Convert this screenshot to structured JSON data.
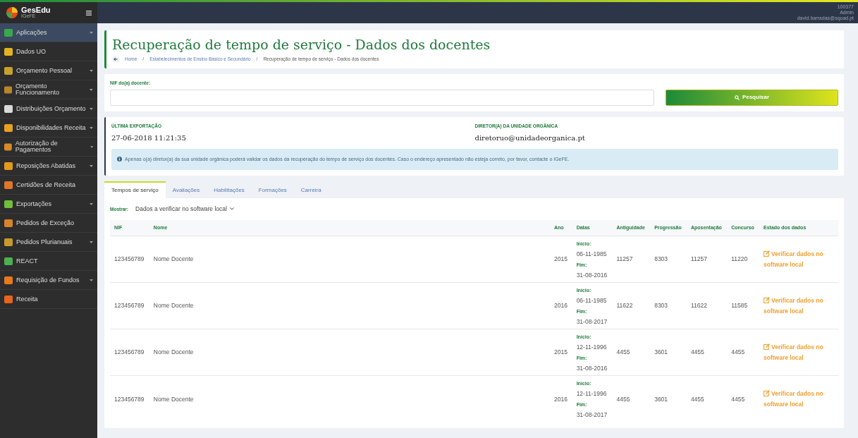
{
  "brand": {
    "name": "GesEdu",
    "sub": "IGeFE"
  },
  "user": {
    "id": "100377",
    "role": "Admin",
    "email": "david.barradas@squad.pt"
  },
  "sidebar": {
    "items": [
      {
        "label": "Aplicações",
        "selected": true,
        "expandable": true,
        "color": "#3aa84a"
      },
      {
        "label": "Dados UO",
        "selected": false,
        "expandable": false,
        "color": "#e3b321"
      },
      {
        "label": "Orçamento Pessoal",
        "selected": false,
        "expandable": true,
        "color": "#c7a12b"
      },
      {
        "label": "Orçamento Funcionamento",
        "selected": false,
        "expandable": true,
        "color": "#b8862b"
      },
      {
        "label": "Distribuições Orçamento",
        "selected": false,
        "expandable": true,
        "color": "#d9d9d9"
      },
      {
        "label": "Disponibilidades Receita",
        "selected": false,
        "expandable": true,
        "color": "#e8a020"
      },
      {
        "label": "Autorização de Pagamentos",
        "selected": false,
        "expandable": true,
        "color": "#d98a2b"
      },
      {
        "label": "Reposições Abatidas",
        "selected": false,
        "expandable": true,
        "color": "#e39a1c"
      },
      {
        "label": "Certidões de Receita",
        "selected": false,
        "expandable": false,
        "color": "#e0762a"
      },
      {
        "label": "Exportações",
        "selected": false,
        "expandable": true,
        "color": "#6fbf3a"
      },
      {
        "label": "Pedidos de Exceção",
        "selected": false,
        "expandable": false,
        "color": "#d9832b"
      },
      {
        "label": "Pedidos Plurianuais",
        "selected": false,
        "expandable": true,
        "color": "#c99a2b"
      },
      {
        "label": "REACT",
        "selected": false,
        "expandable": false,
        "color": "#4caf50"
      },
      {
        "label": "Requisição de Fundos",
        "selected": false,
        "expandable": true,
        "color": "#e87a1c"
      },
      {
        "label": "Receita",
        "selected": false,
        "expandable": false,
        "color": "#e8641c"
      }
    ]
  },
  "page": {
    "title": "Recuperação de tempo de serviço - Dados dos docentes",
    "breadcrumb": [
      {
        "label": "Home",
        "current": false
      },
      {
        "separator": "/",
        "label": "Estabelecimentos de Ensino Básico e Secundário",
        "current": false
      },
      {
        "separator": "/",
        "label": "Recuperação de tempo de serviço - Dados dos docentes",
        "current": true
      }
    ]
  },
  "search": {
    "label": "NIF do(a) docente:",
    "button": "Pesquisar"
  },
  "info": {
    "export_label": "ÚLTIMA EXPORTAÇÃO",
    "export_value": "27-06-2018 11:21:35",
    "director_label": "DIRETOR(A) DA UNIDADE ORGÂNICA",
    "director_value": "diretoruo@unidadeorganica.pt",
    "alert": "Apenas o(a) diretor(a) da sua unidade orgânica poderá validar os dados da recuperação do tempo de serviço dos docentes. Caso o endereço apresentado não esteja correto, por favor, contacte o IGeFE."
  },
  "tabs": [
    {
      "label": "Tempos de serviço",
      "selected": true
    },
    {
      "label": "Avaliações",
      "selected": false
    },
    {
      "label": "Habilitações",
      "selected": false
    },
    {
      "label": "Formações",
      "selected": false
    },
    {
      "label": "Carreira",
      "selected": false
    }
  ],
  "filter": {
    "label": "Mostrar:",
    "value": "Dados a verificar no software local"
  },
  "table": {
    "columns": [
      "NIF",
      "Nome",
      "Ano",
      "Datas",
      "Antiguidade",
      "Progressão",
      "Aposentação",
      "Concurso",
      "Estado dos dados"
    ],
    "rows": [
      {
        "nif": "123456789",
        "nome": "Nome Docente",
        "ano": "2015",
        "inicio_label": "Início:",
        "inicio": "06-11-1985",
        "fim_label": "Fim:",
        "fim": "31-08-2016",
        "antiguidade": "11257",
        "progressao": "8303",
        "aposentacao": "11257",
        "concurso": "11220",
        "estado": "Verificar dados no software local"
      },
      {
        "nif": "123456789",
        "nome": "Nome Docente",
        "ano": "2016",
        "inicio_label": "Início:",
        "inicio": "06-11-1985",
        "fim_label": "Fim:",
        "fim": "31-08-2017",
        "antiguidade": "11622",
        "progressao": "8303",
        "aposentacao": "11622",
        "concurso": "11585",
        "estado": "Verificar dados no software local"
      },
      {
        "nif": "123456789",
        "nome": "Nome Docente",
        "ano": "2015",
        "inicio_label": "Início:",
        "inicio": "12-11-1996",
        "fim_label": "Fim:",
        "fim": "31-08-2016",
        "antiguidade": "4455",
        "progressao": "3601",
        "aposentacao": "4455",
        "concurso": "4455",
        "estado": "Verificar dados no software local"
      },
      {
        "nif": "123456789",
        "nome": "Nome Docente",
        "ano": "2016",
        "inicio_label": "Início:",
        "inicio": "12-11-1996",
        "fim_label": "Fim:",
        "fim": "31-08-2017",
        "antiguidade": "4455",
        "progressao": "3601",
        "aposentacao": "4455",
        "concurso": "4455",
        "estado": "Verificar dados no software local"
      }
    ]
  }
}
